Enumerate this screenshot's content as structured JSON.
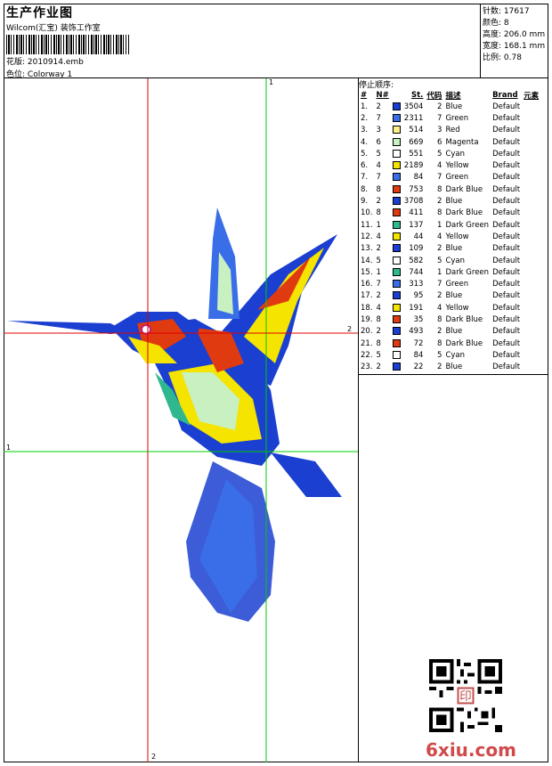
{
  "header": {
    "title": "生产作业图",
    "company": "Wilcom(汇宝) 装饰工作室",
    "pattern_label": "花版:",
    "pattern_value": "2010914.emb",
    "colorway_label": "色位:",
    "colorway_value": "Colorway 1"
  },
  "stats": [
    {
      "label": "针数:",
      "value": "17617"
    },
    {
      "label": "颜色:",
      "value": "8"
    },
    {
      "label": "高度:",
      "value": "206.0 mm"
    },
    {
      "label": "宽度:",
      "value": "168.1 mm"
    },
    {
      "label": "比例:",
      "value": "0.78"
    }
  ],
  "canvas": {
    "axis_labels": {
      "v_red_bottom": "2",
      "v_green_top": "1",
      "h_red_right": "2",
      "h_green_left": "1"
    }
  },
  "stop_sequence": {
    "title": "停止顺序:",
    "columns": [
      "#",
      "N#",
      "St.",
      "代码",
      "描述",
      "Brand",
      "元素"
    ],
    "rows": [
      {
        "idx": "1.",
        "n": "2",
        "color": "#1a3fd1",
        "st": "3504",
        "code": "2",
        "desc": "Blue",
        "brand": "Default"
      },
      {
        "idx": "2.",
        "n": "7",
        "color": "#3a6ee8",
        "st": "2311",
        "code": "7",
        "desc": "Green",
        "brand": "Default"
      },
      {
        "idx": "3.",
        "n": "3",
        "color": "#ffef8a",
        "st": "514",
        "code": "3",
        "desc": "Red",
        "brand": "Default"
      },
      {
        "idx": "4.",
        "n": "6",
        "color": "#c8f0c0",
        "st": "669",
        "code": "6",
        "desc": "Magenta",
        "brand": "Default"
      },
      {
        "idx": "5.",
        "n": "5",
        "color": "#ffffff",
        "st": "551",
        "code": "5",
        "desc": "Cyan",
        "brand": "Default"
      },
      {
        "idx": "6.",
        "n": "4",
        "color": "#f4e400",
        "st": "2189",
        "code": "4",
        "desc": "Yellow",
        "brand": "Default"
      },
      {
        "idx": "7.",
        "n": "7",
        "color": "#3a6ee8",
        "st": "84",
        "code": "7",
        "desc": "Green",
        "brand": "Default"
      },
      {
        "idx": "8.",
        "n": "8",
        "color": "#e03a10",
        "st": "753",
        "code": "8",
        "desc": "Dark Blue",
        "brand": "Default"
      },
      {
        "idx": "9.",
        "n": "2",
        "color": "#1a3fd1",
        "st": "3708",
        "code": "2",
        "desc": "Blue",
        "brand": "Default"
      },
      {
        "idx": "10.",
        "n": "8",
        "color": "#e03a10",
        "st": "411",
        "code": "8",
        "desc": "Dark Blue",
        "brand": "Default"
      },
      {
        "idx": "11.",
        "n": "1",
        "color": "#2fb890",
        "st": "137",
        "code": "1",
        "desc": "Dark Green",
        "brand": "Default"
      },
      {
        "idx": "12.",
        "n": "4",
        "color": "#f4e400",
        "st": "44",
        "code": "4",
        "desc": "Yellow",
        "brand": "Default"
      },
      {
        "idx": "13.",
        "n": "2",
        "color": "#1a3fd1",
        "st": "109",
        "code": "2",
        "desc": "Blue",
        "brand": "Default"
      },
      {
        "idx": "14.",
        "n": "5",
        "color": "#ffffff",
        "st": "582",
        "code": "5",
        "desc": "Cyan",
        "brand": "Default"
      },
      {
        "idx": "15.",
        "n": "1",
        "color": "#2fb890",
        "st": "744",
        "code": "1",
        "desc": "Dark Green",
        "brand": "Default"
      },
      {
        "idx": "16.",
        "n": "7",
        "color": "#3a6ee8",
        "st": "313",
        "code": "7",
        "desc": "Green",
        "brand": "Default"
      },
      {
        "idx": "17.",
        "n": "2",
        "color": "#1a3fd1",
        "st": "95",
        "code": "2",
        "desc": "Blue",
        "brand": "Default"
      },
      {
        "idx": "18.",
        "n": "4",
        "color": "#f4e400",
        "st": "191",
        "code": "4",
        "desc": "Yellow",
        "brand": "Default"
      },
      {
        "idx": "19.",
        "n": "8",
        "color": "#e03a10",
        "st": "35",
        "code": "8",
        "desc": "Dark Blue",
        "brand": "Default"
      },
      {
        "idx": "20.",
        "n": "2",
        "color": "#1a3fd1",
        "st": "493",
        "code": "2",
        "desc": "Blue",
        "brand": "Default"
      },
      {
        "idx": "21.",
        "n": "8",
        "color": "#e03a10",
        "st": "72",
        "code": "8",
        "desc": "Dark Blue",
        "brand": "Default"
      },
      {
        "idx": "22.",
        "n": "5",
        "color": "#ffffff",
        "st": "84",
        "code": "5",
        "desc": "Cyan",
        "brand": "Default"
      },
      {
        "idx": "23.",
        "n": "2",
        "color": "#1a3fd1",
        "st": "22",
        "code": "2",
        "desc": "Blue",
        "brand": "Default"
      }
    ]
  },
  "watermark": {
    "text": "6xiu.com",
    "seal_text": "印"
  }
}
